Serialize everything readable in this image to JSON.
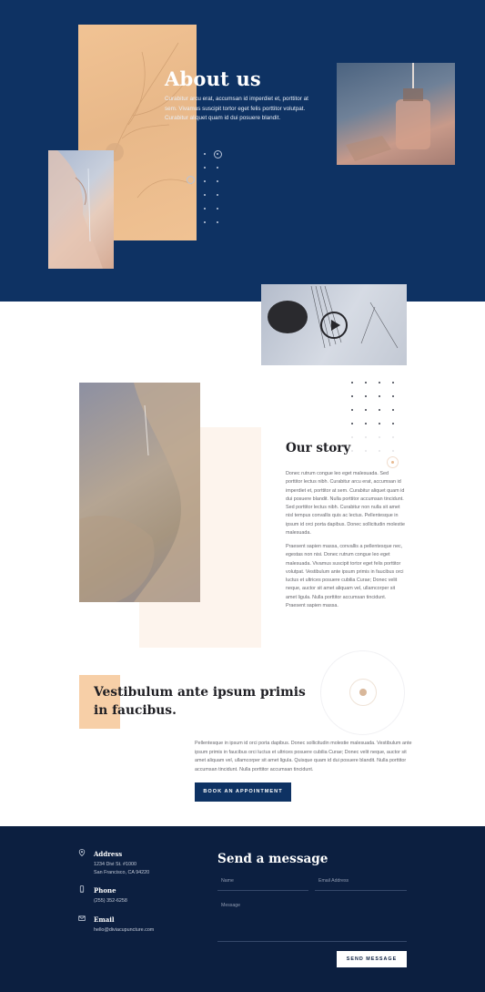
{
  "about": {
    "title": "About us",
    "text": "Curabitur arcu erat, accumsan id imperdiet et, porttitor at sem. Vivamus suscipit tortor eget felis porttitor volutpat. Curabitur aliquet quam id dui posuere blandit."
  },
  "video": {
    "play_icon": "play-icon"
  },
  "story": {
    "title": "Our story",
    "paragraph_1": "Donec rutrum congue leo eget malesuada. Sed porttitor lectus nibh. Curabitur arcu erat, accumsan id imperdiet et, porttitor at sem. Curabitur aliquet quam id dui posuere blandit. Nulla porttitor accumsan tincidunt. Sed porttitor lectus nibh. Curabitur non nulla sit amet nisl tempus convallis quis ac lectus. Pellentesque in ipsum id orci porta dapibus. Donec sollicitudin molestie malesuada.",
    "paragraph_2": "Praesent sapien massa, convallis a pellentesque nec, egestas non nisi. Donec rutrum congue leo eget malesuada. Vivamus suscipit tortor eget felis porttitor volutpat. Vestibulum ante ipsum primis in faucibus orci luctus et ultrices posuere cubilia Curae; Donec velit neque, auctor sit amet aliquam vel, ullamcorper sit amet ligula. Nulla porttitor accumsan tincidunt. Praesent sapien massa."
  },
  "feature": {
    "title": "Vestibulum ante ipsum primis in faucibus.",
    "text": "Pellentesque in ipsum id orci porta dapibus. Donec sollicitudin molestie malesuada. Vestibulum ante ipsum primis in faucibus orci luctus et ultrices posuere cubilia Curae; Donec velit neque, auctor sit amet aliquam vel, ullamcorper sit amet ligula. Quisque quam id dui posuere blandit. Nulla porttitor accumsan tincidunt. Nulla porttitor accumsan tincidunt.",
    "button_label": "BOOK AN APPOINTMENT"
  },
  "footer": {
    "address_label": "Address",
    "address_line_1": "1234 Divi St. #1000",
    "address_line_2": "San Francisco, CA 94220",
    "phone_label": "Phone",
    "phone_value": "(255) 352-6258",
    "email_label": "Email",
    "email_value": "hello@diviacupuncture.com",
    "form_title": "Send a message",
    "name_placeholder": "Name",
    "email_placeholder": "Email Address",
    "message_placeholder": "Message",
    "send_label": "SEND MESSAGE"
  },
  "colors": {
    "navy": "#0e3263",
    "footer_navy": "#0c1f40",
    "peach": "#f1c394",
    "light_peach": "#fdf4ed",
    "text_dark": "#1f1f24"
  }
}
